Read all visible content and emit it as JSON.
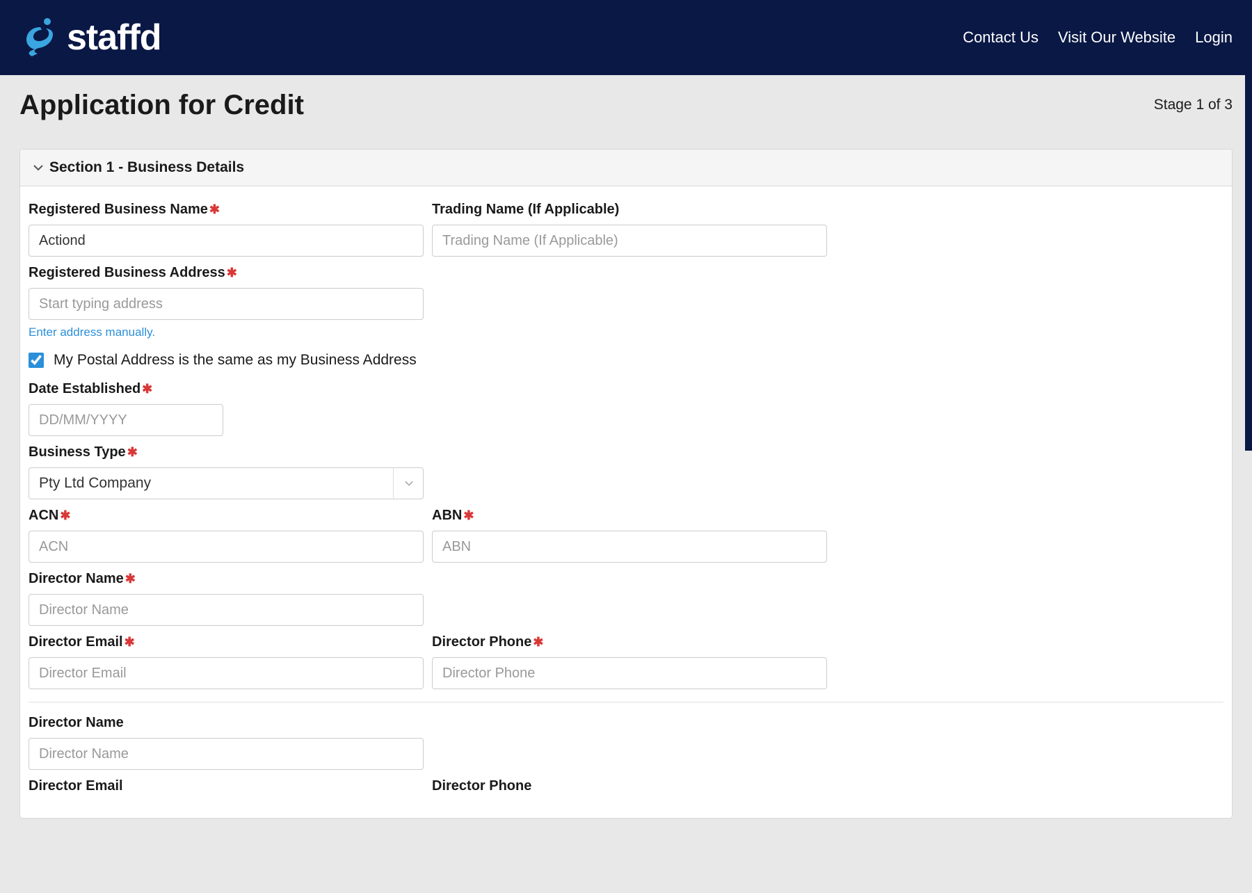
{
  "brand": {
    "name": "staffd"
  },
  "nav": {
    "contact": "Contact Us",
    "visit": "Visit Our Website",
    "login": "Login"
  },
  "page": {
    "title": "Application for Credit",
    "stage": "Stage 1 of 3"
  },
  "section1": {
    "title": "Section 1 - Business Details",
    "fields": {
      "business_name": {
        "label": "Registered Business Name",
        "value": "Actiond",
        "required": true
      },
      "trading_name": {
        "label": "Trading Name (If Applicable)",
        "placeholder": "Trading Name (If Applicable)",
        "required": false
      },
      "business_address": {
        "label": "Registered Business Address",
        "placeholder": "Start typing address",
        "required": true,
        "manual_link": "Enter address manually."
      },
      "postal_same": {
        "label": "My Postal Address is the same as my Business Address",
        "checked": true
      },
      "date_established": {
        "label": "Date Established",
        "placeholder": "DD/MM/YYYY",
        "required": true
      },
      "business_type": {
        "label": "Business Type",
        "selected": "Pty Ltd Company",
        "required": true
      },
      "acn": {
        "label": "ACN",
        "placeholder": "ACN",
        "required": true
      },
      "abn": {
        "label": "ABN",
        "placeholder": "ABN",
        "required": true
      },
      "director1_name": {
        "label": "Director Name",
        "placeholder": "Director Name",
        "required": true
      },
      "director1_email": {
        "label": "Director Email",
        "placeholder": "Director Email",
        "required": true
      },
      "director1_phone": {
        "label": "Director Phone",
        "placeholder": "Director Phone",
        "required": true
      },
      "director2_name": {
        "label": "Director Name",
        "placeholder": "Director Name",
        "required": false
      },
      "director2_email": {
        "label": "Director Email",
        "required": false
      },
      "director2_phone": {
        "label": "Director Phone",
        "required": false
      }
    }
  }
}
